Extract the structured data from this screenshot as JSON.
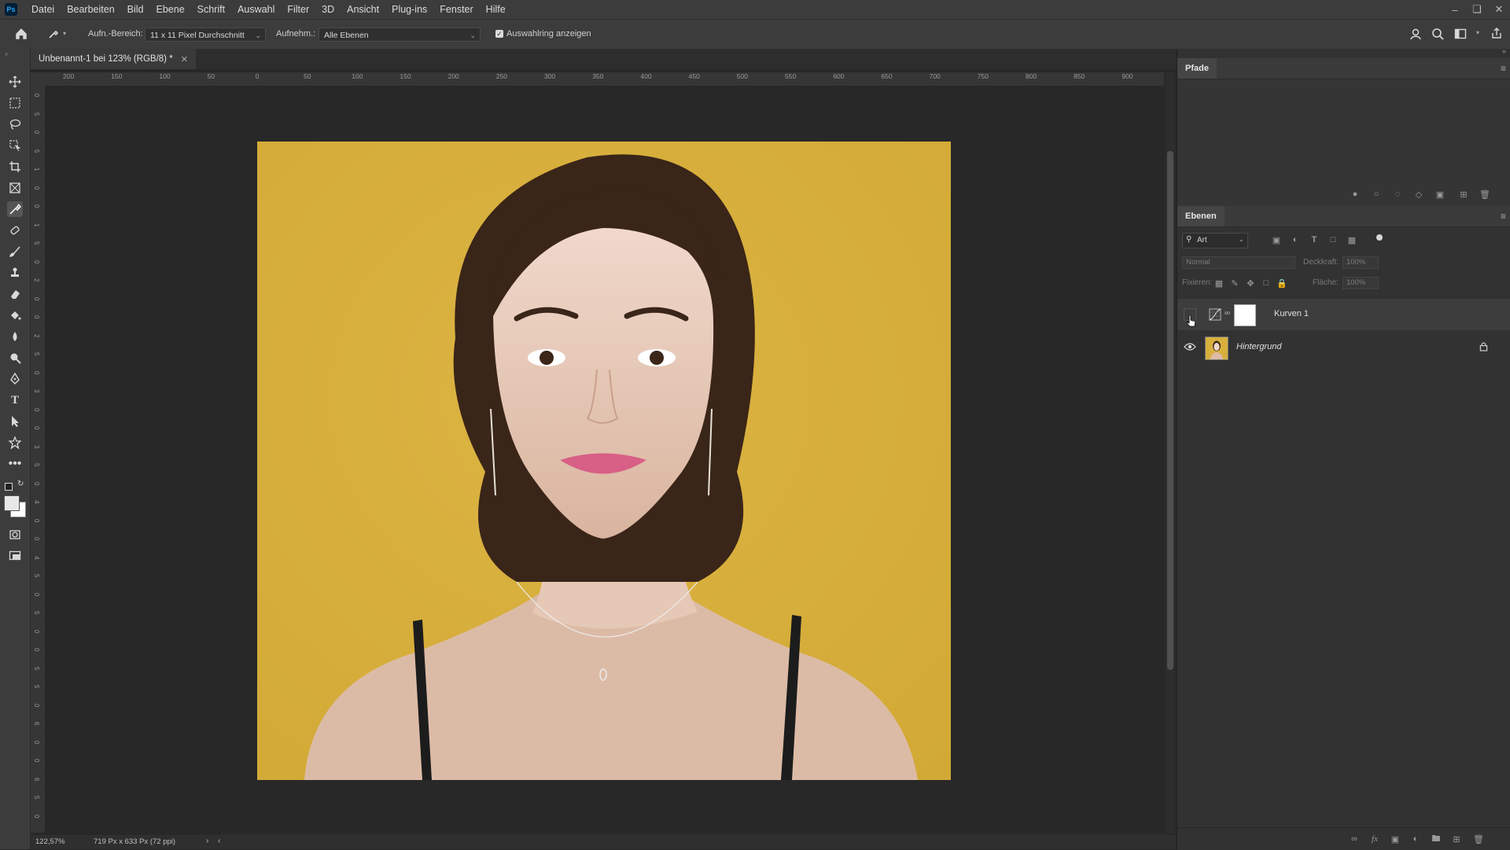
{
  "menubar": {
    "app_logo": "Ps",
    "items": [
      "Datei",
      "Bearbeiten",
      "Bild",
      "Ebene",
      "Schrift",
      "Auswahl",
      "Filter",
      "3D",
      "Ansicht",
      "Plug-ins",
      "Fenster",
      "Hilfe"
    ]
  },
  "optionsbar": {
    "sample_size_label": "Aufn.-Bereich:",
    "sample_size_value": "11 x 11 Pixel Durchschnitt",
    "sample_label": "Aufnehm.:",
    "sample_value": "Alle Ebenen",
    "show_ring_label": "Auswahlring anzeigen",
    "show_ring_checked": true
  },
  "document": {
    "tab_title": "Unbenannt-1 bei 123% (RGB/8) *",
    "ruler_h_ticks": [
      "200",
      "150",
      "100",
      "50",
      "0",
      "50",
      "100",
      "150",
      "200",
      "250",
      "300",
      "350",
      "400",
      "450",
      "500",
      "550",
      "600",
      "650",
      "700",
      "750",
      "800",
      "850",
      "900"
    ],
    "ruler_v_ticks": [
      "0",
      "5",
      "0",
      "5",
      "1",
      "0",
      "0",
      "1",
      "5",
      "0",
      "2",
      "0",
      "0",
      "2",
      "5",
      "0",
      "3",
      "0",
      "0",
      "3",
      "5",
      "0",
      "4",
      "0",
      "0",
      "4",
      "5",
      "0",
      "5",
      "0",
      "0",
      "5",
      "5",
      "0",
      "6",
      "0",
      "0",
      "6",
      "5",
      "0"
    ]
  },
  "statusbar": {
    "zoom": "122,57%",
    "doc_info": "719 Px x 633 Px (72 ppi)"
  },
  "paths_panel": {
    "title": "Pfade"
  },
  "layers_panel": {
    "title": "Ebenen",
    "filter_kind": "Art",
    "blend_mode": "Normal",
    "opacity_label": "Deckkraft:",
    "opacity_value": "100%",
    "lock_label": "Fixieren:",
    "fill_label": "Fläche:",
    "fill_value": "100%",
    "layers": [
      {
        "name": "Kurven 1",
        "visible": false,
        "type": "adjustment-curves"
      },
      {
        "name": "Hintergrund",
        "visible": true,
        "type": "background",
        "locked": true
      }
    ]
  },
  "colors": {
    "photo_background": "#d7b03d",
    "app_bg": "#282828",
    "panel_bg": "#323232"
  }
}
